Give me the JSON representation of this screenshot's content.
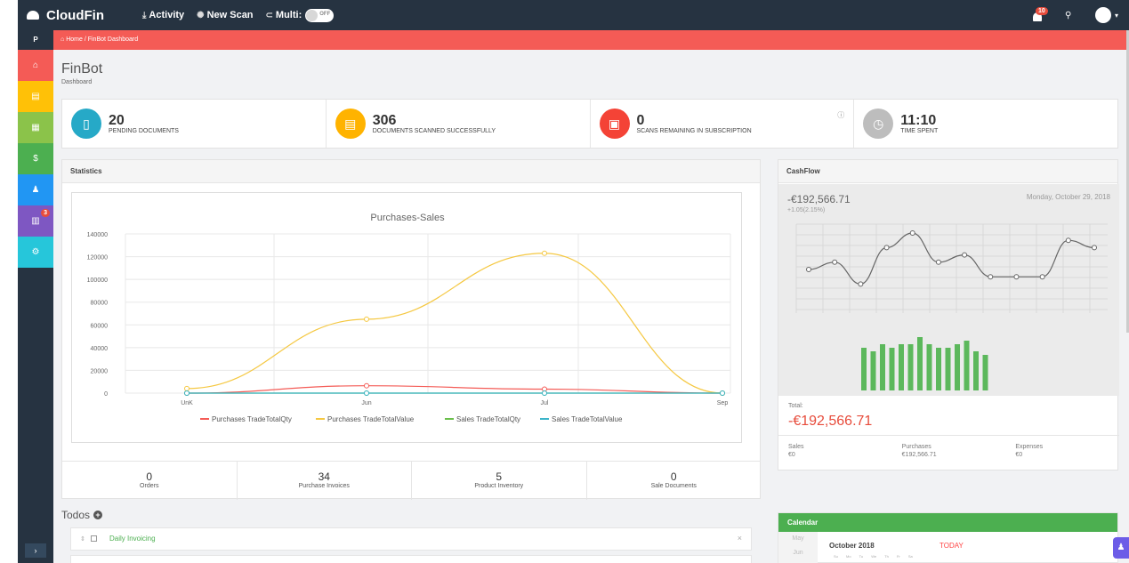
{
  "colors": {
    "topbar": "#263341",
    "accent": "#f45b56",
    "success": "#4caf50"
  },
  "app": {
    "name": "CloudFin"
  },
  "topnav": {
    "links": [
      {
        "label": "Activity",
        "icon": "download-icon"
      },
      {
        "label": "New Scan",
        "icon": "scan-icon"
      },
      {
        "label": "Multi:",
        "icon": "link-icon"
      }
    ],
    "toggle_text": "OFF",
    "notifications": "10"
  },
  "sidebar": {
    "top_label": "P",
    "items": [
      {
        "name": "home",
        "color": "#f45b56",
        "glyph": "⌂"
      },
      {
        "name": "documents",
        "color": "#ffc107",
        "glyph": "▤"
      },
      {
        "name": "invoices",
        "color": "#8bc34a",
        "glyph": "▦"
      },
      {
        "name": "finance",
        "color": "#4caf50",
        "glyph": "$"
      },
      {
        "name": "users",
        "color": "#2196f3",
        "glyph": "♟"
      },
      {
        "name": "reports",
        "color": "#7e57c2",
        "glyph": "▥",
        "badge": "3"
      },
      {
        "name": "settings",
        "color": "#26c6da",
        "glyph": "⚙"
      }
    ],
    "collapse": "›"
  },
  "breadcrumb": {
    "home": "Home",
    "current": "FinBot Dashboard"
  },
  "page": {
    "title": "FinBot",
    "subtitle": "Dashboard"
  },
  "stats": [
    {
      "value": "20",
      "label": "PENDING DOCUMENTS",
      "color": "#26a9c7",
      "glyph": "▯"
    },
    {
      "value": "306",
      "label": "DOCUMENTS SCANNED SUCCESSFULLY",
      "color": "#ffb300",
      "glyph": "▤"
    },
    {
      "value": "0",
      "label": "SCANS REMAINING IN SUBSCRIPTION",
      "color": "#f44336",
      "glyph": "▣",
      "info": "ⓘ"
    },
    {
      "value": "11:10",
      "label": "TIME SPENT",
      "color": "#bdbdbd",
      "glyph": "◷"
    }
  ],
  "statistics": {
    "header": "Statistics",
    "counts": [
      {
        "value": "0",
        "label": "Orders"
      },
      {
        "value": "34",
        "label": "Purchase Invoices"
      },
      {
        "value": "5",
        "label": "Product Inventory"
      },
      {
        "value": "0",
        "label": "Sale Documents"
      }
    ]
  },
  "chart_data": {
    "type": "line",
    "title": "Purchases-Sales",
    "categories": [
      "UnK",
      "Jun",
      "Jul",
      "Sep"
    ],
    "ylim": [
      0,
      140000
    ],
    "yticks": [
      0,
      20000,
      40000,
      60000,
      80000,
      100000,
      120000,
      140000
    ],
    "grid": true,
    "legend_position": "bottom",
    "series": [
      {
        "name": "Purchases TradeTotalQty",
        "color": "#f45b56",
        "values": [
          0,
          6500,
          3500,
          0
        ]
      },
      {
        "name": "Purchases TradeTotalValue",
        "color": "#f5c842",
        "values": [
          4000,
          65000,
          123000,
          0
        ]
      },
      {
        "name": "Sales TradeTotalQty",
        "color": "#6abf4b",
        "values": [
          0,
          0,
          0,
          0
        ]
      },
      {
        "name": "Sales TradeTotalValue",
        "color": "#3bb4c9",
        "values": [
          0,
          0,
          0,
          0
        ]
      }
    ]
  },
  "cashflow": {
    "header": "CashFlow",
    "amount": "-€192,566.71",
    "change": "+1.05(2.15%)",
    "date": "Monday, October 29, 2018",
    "total_label": "Total:",
    "total": "-€192,566.71",
    "columns": [
      {
        "label": "Sales",
        "value": "€0"
      },
      {
        "label": "Purchases",
        "value": "€192,566.71"
      },
      {
        "label": "Expenses",
        "value": "€0"
      }
    ],
    "sparkline": [
      5,
      6,
      3,
      8,
      10,
      6,
      7,
      4,
      4,
      4,
      9,
      8
    ],
    "bars": [
      6,
      5.5,
      6.5,
      6,
      6.5,
      6.5,
      7.5,
      6.5,
      6,
      6,
      6.5,
      7,
      5.5,
      5
    ]
  },
  "todos": {
    "header": "Todos",
    "items": [
      {
        "label": "Daily Invoicing"
      }
    ]
  },
  "calendar": {
    "header": "Calendar",
    "month": "October 2018",
    "today": "TODAY",
    "side_months": [
      "May",
      "Jun"
    ],
    "weekdays": "Su Mo Tu We Th Fr Sa"
  }
}
